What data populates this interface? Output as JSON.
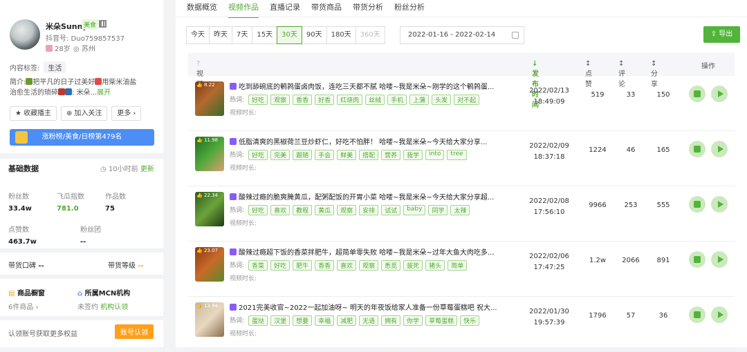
{
  "profile": {
    "name": "米朵Sunny",
    "category_tag": "美食",
    "douyin_id": "抖音号: Duo759857537",
    "age": "28岁",
    "location": "苏州",
    "content_tag_label": "内容标签:",
    "content_tag": "生活",
    "intro_label": "简介:",
    "intro_1": "把平凡的日子过美好",
    "intro_2": "用柴米油盐",
    "intro_3": "治愈生活的琐碎",
    "intro_4": "米朵...",
    "intro_more": "展开",
    "btn_collect": "收藏播主",
    "btn_follow": "加入关注",
    "btn_more": "更多",
    "rank_text": "涨粉榜/美食/日榜第479名"
  },
  "basic": {
    "title": "基础数据",
    "updated": "10小时前",
    "update_link": "更新",
    "fans_label": "粉丝数",
    "fans": "33.4w",
    "fg_label": "飞瓜指数",
    "fg": "781.0",
    "works_label": "作品数",
    "works": "75",
    "likes_label": "点赞数",
    "likes": "463.7w",
    "fangroup_label": "粉丝团",
    "fangroup": "--",
    "sell_label": "带货口碑",
    "sell_value": "--",
    "level_label": "带货等级",
    "level_value": "--",
    "shop_label": "商品橱窗",
    "shop_value": "6件商品",
    "mcn_label": "所属MCN机构",
    "mcn_value": "未签约",
    "mcn_link": "机构认领",
    "claim_text": "认领账号获取更多权益",
    "claim_btn": "账号认领"
  },
  "tabs": [
    "数据概览",
    "视频作品",
    "直播记录",
    "带货商品",
    "带货分析",
    "粉丝分析"
  ],
  "ranges": [
    "今天",
    "昨天",
    "7天",
    "15天",
    "30天",
    "90天",
    "180天",
    "360天"
  ],
  "date_range": "2022-01-16  -  2022-02-14",
  "export_label": "导出",
  "table": {
    "h_content": "视频内容",
    "h_time": "发布时间",
    "h_likes": "点赞",
    "h_comments": "评论",
    "h_shares": "分享",
    "h_ops": "操作",
    "hot_label": "热词:",
    "dur_label": "视频时长:"
  },
  "rows": [
    {
      "like": "8.22",
      "title": "吃到舔碗底的鹌鹑蛋卤肉饭，连吃三天都不腻 哈喽~我是米朵~刚学的这个鹌鹑蛋...",
      "tags": [
        "好吃",
        "观察",
        "香香",
        "好香",
        "红烧肉",
        "丝绒",
        "手机",
        "上蒲",
        "头发",
        "对不起"
      ],
      "date": "2022/02/13",
      "time": "18:49:09",
      "likes": "519",
      "comments": "33",
      "shares": "150"
    },
    {
      "like": "11.98",
      "title": "低脂清爽的黑椒荷兰豆炒虾仁，好吃不怕胖！ 哈喽~我是米朵~今天给大家分享...",
      "tags": [
        "好吃",
        "完美",
        "跟随",
        "手会",
        "鲜美",
        "搭配",
        "营养",
        "我学",
        "into",
        "tree"
      ],
      "date": "2022/02/09",
      "time": "18:37:18",
      "likes": "1224",
      "comments": "46",
      "shares": "165"
    },
    {
      "like": "22.34",
      "title": "酸辣过瘾的脆爽腌黄瓜，配粥配饭的开胃小菜 哈喽~我是米朵~今天给大家分享超...",
      "tags": [
        "好吃",
        "喜欢",
        "教程",
        "黄瓜",
        "观察",
        "安排",
        "试试",
        "baby",
        "同学",
        "太辣"
      ],
      "date": "2022/02/08",
      "time": "17:56:10",
      "likes": "9966",
      "comments": "253",
      "shares": "555"
    },
    {
      "like": "23.07",
      "title": "酸辣过瘾超下饭的香菜拌肥牛，超简单零失败 哈喽~我是米朵~过年大鱼大肉吃多...",
      "tags": [
        "香菜",
        "好吃",
        "肥牛",
        "香香",
        "喜欢",
        "观察",
        "悉觅",
        "拔死",
        "猪头",
        "简单"
      ],
      "date": "2022/02/06",
      "time": "17:47:25",
      "likes": "1.2w",
      "comments": "2066",
      "shares": "891"
    },
    {
      "like": "13.94",
      "title": "2021完美收官~2022一起加油呀~ 明天的年夜饭给家人准备一份草莓蛋糕吧 祝大...",
      "tags": [
        "蛋挞",
        "汉堡",
        "想要",
        "幸福",
        "减肥",
        "无语",
        "拥有",
        "你学",
        "草莓蛋糕",
        "快乐"
      ],
      "date": "2022/01/30",
      "time": "19:57:39",
      "likes": "1796",
      "comments": "57",
      "shares": "36"
    }
  ],
  "colors": {
    "accent": "#52a830",
    "rank_bar": "#4b8ef5",
    "claim": "#ff9f1a"
  }
}
